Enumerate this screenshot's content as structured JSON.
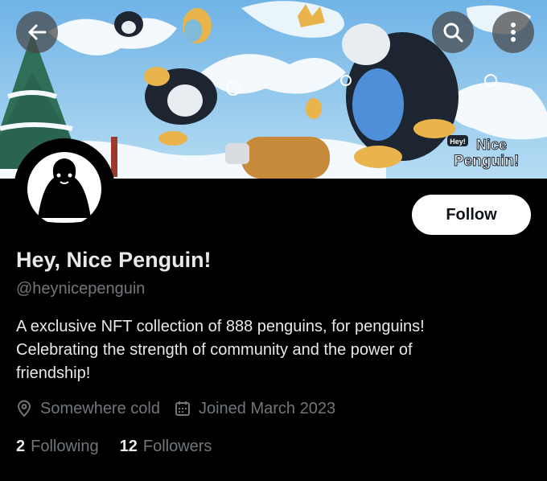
{
  "header": {
    "back_icon": "arrow-left-icon",
    "search_icon": "search-icon",
    "more_icon": "more-vertical-icon",
    "banner_logo_top": "Hey!",
    "banner_logo_line1": "Nice",
    "banner_logo_line2": "Penguin!"
  },
  "profile": {
    "follow_label": "Follow",
    "display_name": "Hey, Nice Penguin!",
    "handle": "@heynicepenguin",
    "bio_line1": "A exclusive NFT collection of 888 penguins, for penguins!",
    "bio_line2": "Celebrating the strength of community and the power of",
    "bio_line3": "friendship!",
    "location": "Somewhere cold",
    "location_icon": "location-pin-icon",
    "joined": "Joined March 2023",
    "joined_icon": "calendar-icon",
    "following_count": "2",
    "following_label": "Following",
    "followers_count": "12",
    "followers_label": "Followers"
  },
  "colors": {
    "background": "#000000",
    "primary_text": "#e7e9ea",
    "secondary_text": "#71767b",
    "follow_button_bg": "#ffffff",
    "follow_button_text": "#0f1419"
  }
}
